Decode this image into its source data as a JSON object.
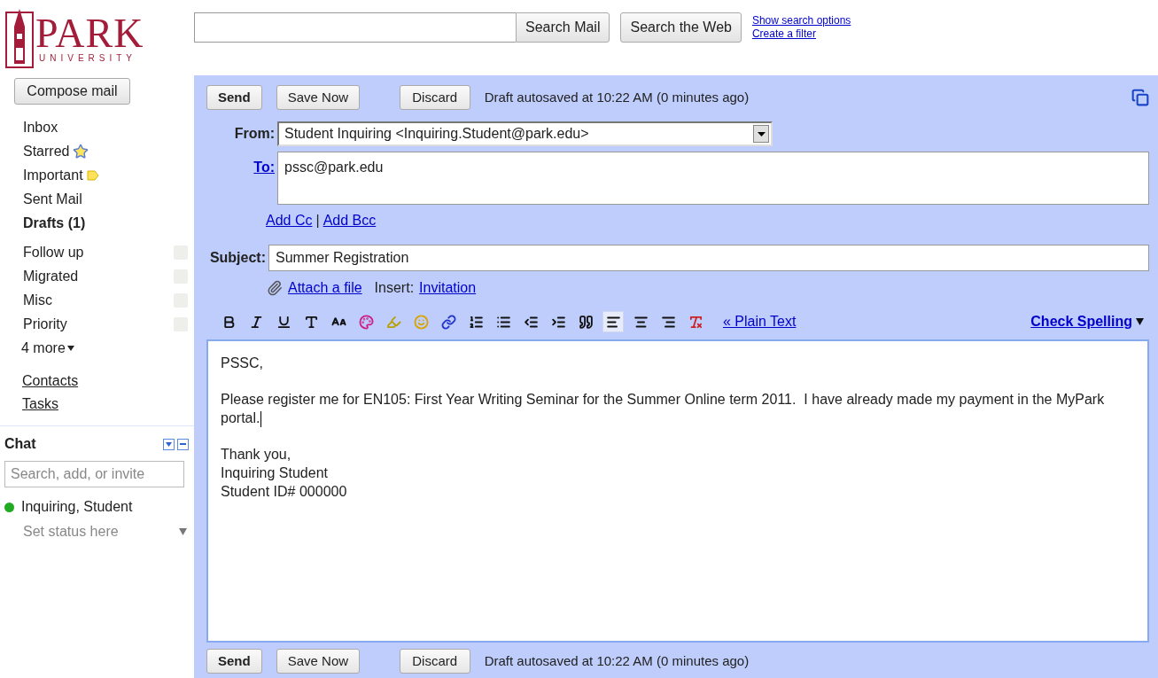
{
  "logo": {
    "name": "PARK",
    "sub": "UNIVERSITY"
  },
  "search": {
    "buttons": [
      "Search Mail",
      "Search the Web"
    ],
    "links": [
      "Show search options",
      "Create a filter"
    ]
  },
  "sidebar": {
    "compose": "Compose mail",
    "items": [
      {
        "label": "Inbox",
        "kind": "plain",
        "selected": false
      },
      {
        "label": "Starred",
        "kind": "starred",
        "selected": false
      },
      {
        "label": "Important",
        "kind": "important",
        "selected": false
      },
      {
        "label": "Sent Mail",
        "kind": "plain",
        "selected": false
      },
      {
        "label": "Drafts (1)",
        "kind": "plain",
        "selected": true
      }
    ],
    "labels": [
      "Follow up",
      "Migrated",
      "Misc",
      "Priority"
    ],
    "more": "4 more",
    "links": [
      "Contacts",
      "Tasks"
    ]
  },
  "chat": {
    "title": "Chat",
    "placeholder": "Search, add, or invite",
    "user": {
      "name": "Inquiring, Student",
      "color": "#22aa22"
    },
    "status": "Set status here"
  },
  "compose": {
    "buttons": [
      "Send",
      "Save Now",
      "Discard"
    ],
    "autosave": "Draft autosaved at 10:22 AM (0 minutes ago)",
    "from_label": "From:",
    "from": "Student Inquiring <Inquiring.Student@park.edu>",
    "to_label": "To:",
    "to": "pssc@park.edu",
    "add_cc": "Add Cc",
    "cc_separator": "|",
    "add_bcc": "Add Bcc",
    "subject_label": "Subject:",
    "subject": "Summer Registration",
    "attach": "Attach a file",
    "insert_label": "Insert:",
    "insert": "Invitation",
    "toolbar": [
      {
        "kind": "bold",
        "selected": false
      },
      {
        "kind": "italic",
        "selected": false
      },
      {
        "kind": "underline",
        "selected": false
      },
      {
        "kind": "font",
        "selected": false
      },
      {
        "kind": "size",
        "selected": false
      },
      {
        "kind": "color",
        "selected": false
      },
      {
        "kind": "highlight",
        "selected": false
      },
      {
        "kind": "emoji",
        "selected": false
      },
      {
        "kind": "link",
        "selected": false
      },
      {
        "kind": "numbered",
        "selected": false
      },
      {
        "kind": "bullets",
        "selected": false
      },
      {
        "kind": "outdent",
        "selected": false
      },
      {
        "kind": "indent",
        "selected": false
      },
      {
        "kind": "quote",
        "selected": false
      },
      {
        "kind": "align-left",
        "selected": true
      },
      {
        "kind": "align-center",
        "selected": false
      },
      {
        "kind": "align-right",
        "selected": false
      },
      {
        "kind": "clear",
        "selected": false
      }
    ],
    "plain_text": "« Plain Text",
    "check_spelling": "Check Spelling",
    "body": [
      [
        "PSSC,"
      ],
      [
        "Please register me for EN105: First Year Writing Seminar for the Summer Online term 2011.  I have already made my payment in the MyPark portal."
      ],
      [
        "Thank you,",
        "Inquiring Student",
        "Student ID# 000000"
      ]
    ],
    "bottom_buttons": [
      "Send",
      "Save Now",
      "Discard"
    ],
    "bottom_autosave": "Draft autosaved at 10:22 AM (0 minutes ago)"
  }
}
